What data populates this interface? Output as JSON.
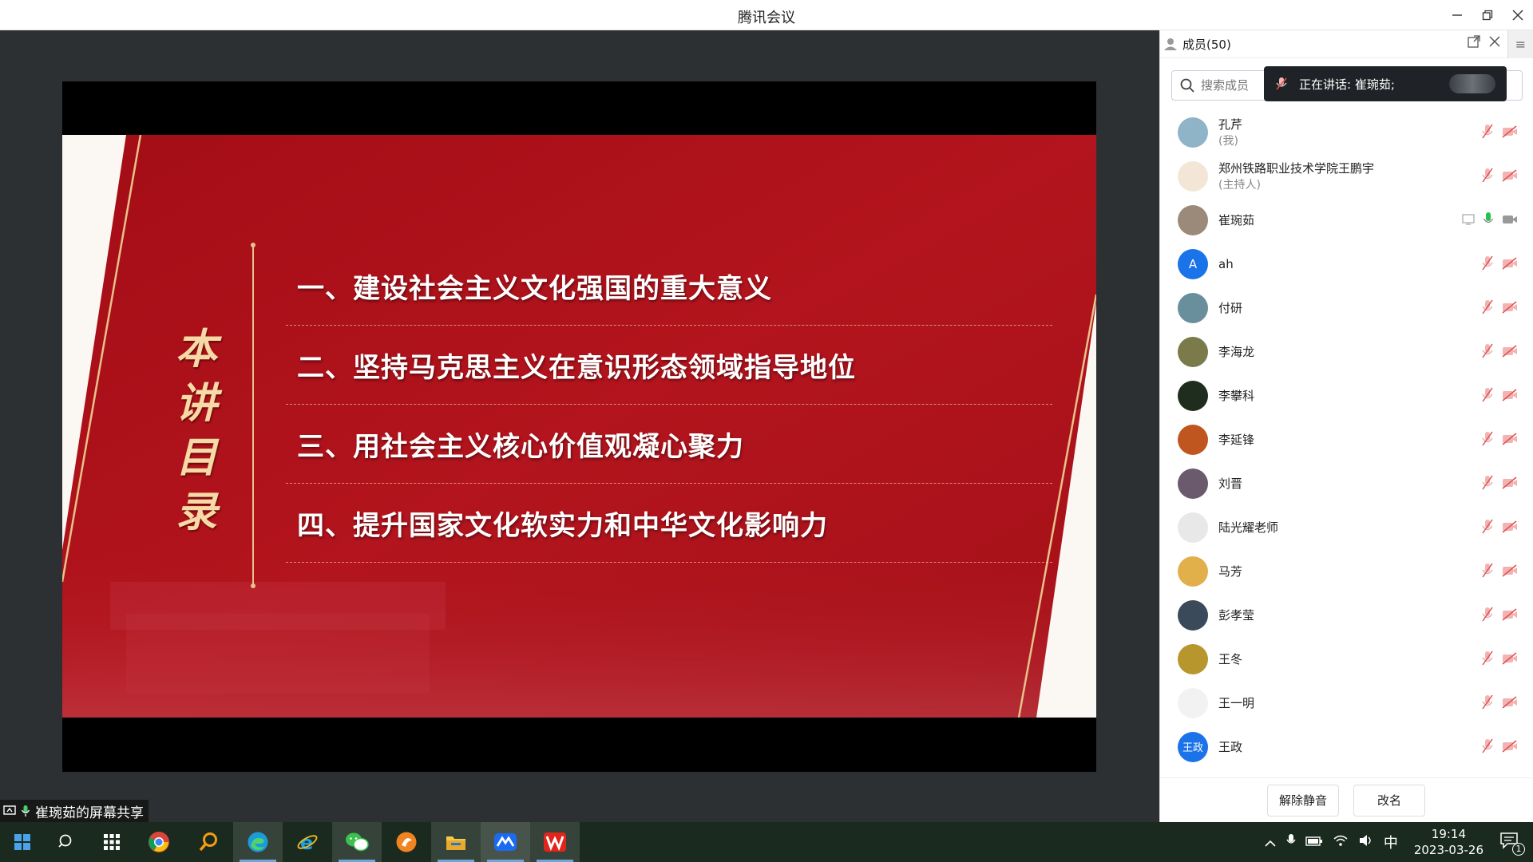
{
  "window": {
    "title": "腾讯会议"
  },
  "slide": {
    "vertical_title": [
      "本",
      "讲",
      "目",
      "录"
    ],
    "items": [
      "一、建设社会主义文化强国的重大意义",
      "二、坚持马克思主义在意识形态领域指导地位",
      "三、用社会主义核心价值观凝心聚力",
      "四、提升国家文化软实力和中华文化影响力"
    ]
  },
  "share_badge": {
    "label": "崔琬茹的屏幕共享"
  },
  "panel": {
    "title": "成员(50)",
    "search_placeholder": "搜索成员",
    "speaking": "正在讲话: 崔琬茹;",
    "members": [
      {
        "name": "孔芹",
        "role": "(我)",
        "avatar_color": "#8fb3c7",
        "avatar_text": "",
        "mic": "muted",
        "cam": "off",
        "sharing": false
      },
      {
        "name": "郑州铁路职业技术学院王鹏宇",
        "role": "(主持人)",
        "avatar_color": "#f3e6d6",
        "avatar_text": "",
        "mic": "muted",
        "cam": "off",
        "sharing": false
      },
      {
        "name": "崔琬茹",
        "role": "",
        "avatar_color": "#9b8a7a",
        "avatar_text": "",
        "mic": "active",
        "cam": "on",
        "sharing": true
      },
      {
        "name": "ah",
        "role": "",
        "avatar_color": "#1a73e8",
        "avatar_text": "A",
        "mic": "muted",
        "cam": "off",
        "sharing": false
      },
      {
        "name": "付研",
        "role": "",
        "avatar_color": "#6a8f9c",
        "avatar_text": "",
        "mic": "muted",
        "cam": "off",
        "sharing": false
      },
      {
        "name": "李海龙",
        "role": "",
        "avatar_color": "#7a7a4a",
        "avatar_text": "",
        "mic": "muted",
        "cam": "off",
        "sharing": false
      },
      {
        "name": "李攀科",
        "role": "",
        "avatar_color": "#1f2d1f",
        "avatar_text": "",
        "mic": "muted",
        "cam": "off",
        "sharing": false
      },
      {
        "name": "李延锋",
        "role": "",
        "avatar_color": "#c0561f",
        "avatar_text": "",
        "mic": "muted",
        "cam": "off",
        "sharing": false
      },
      {
        "name": "刘晋",
        "role": "",
        "avatar_color": "#6b5a6e",
        "avatar_text": "",
        "mic": "muted",
        "cam": "off",
        "sharing": false
      },
      {
        "name": "陆光耀老师",
        "role": "",
        "avatar_color": "#e8e8e8",
        "avatar_text": "",
        "mic": "muted",
        "cam": "off",
        "sharing": false
      },
      {
        "name": "马芳",
        "role": "",
        "avatar_color": "#e2b04a",
        "avatar_text": "",
        "mic": "muted",
        "cam": "off",
        "sharing": false
      },
      {
        "name": "彭孝莹",
        "role": "",
        "avatar_color": "#3a4a5a",
        "avatar_text": "",
        "mic": "muted",
        "cam": "off",
        "sharing": false
      },
      {
        "name": "王冬",
        "role": "",
        "avatar_color": "#b8962e",
        "avatar_text": "",
        "mic": "muted",
        "cam": "off",
        "sharing": false
      },
      {
        "name": "王一明",
        "role": "",
        "avatar_color": "#f2f2f2",
        "avatar_text": "",
        "mic": "muted",
        "cam": "off",
        "sharing": false
      },
      {
        "name": "王政",
        "role": "",
        "avatar_color": "#1a73e8",
        "avatar_text": "王政",
        "mic": "muted",
        "cam": "off",
        "sharing": false
      }
    ],
    "unmute_button": "解除静音",
    "rename_button": "改名"
  },
  "taskbar": {
    "apps": [
      "windows-start",
      "search",
      "task-view",
      "chrome",
      "search-tool",
      "edge",
      "internet-explorer",
      "wechat",
      "app-orange",
      "file-explorer",
      "tencent-meeting",
      "wps-office"
    ],
    "time": "19:14",
    "date": "2023-03-26",
    "ime": "中",
    "notification_count": "1"
  },
  "colors": {
    "slide_red": "#b1121b",
    "gold": "#f6d9a6",
    "blue": "#1a73e8",
    "speaking_green": "#27c24c"
  }
}
